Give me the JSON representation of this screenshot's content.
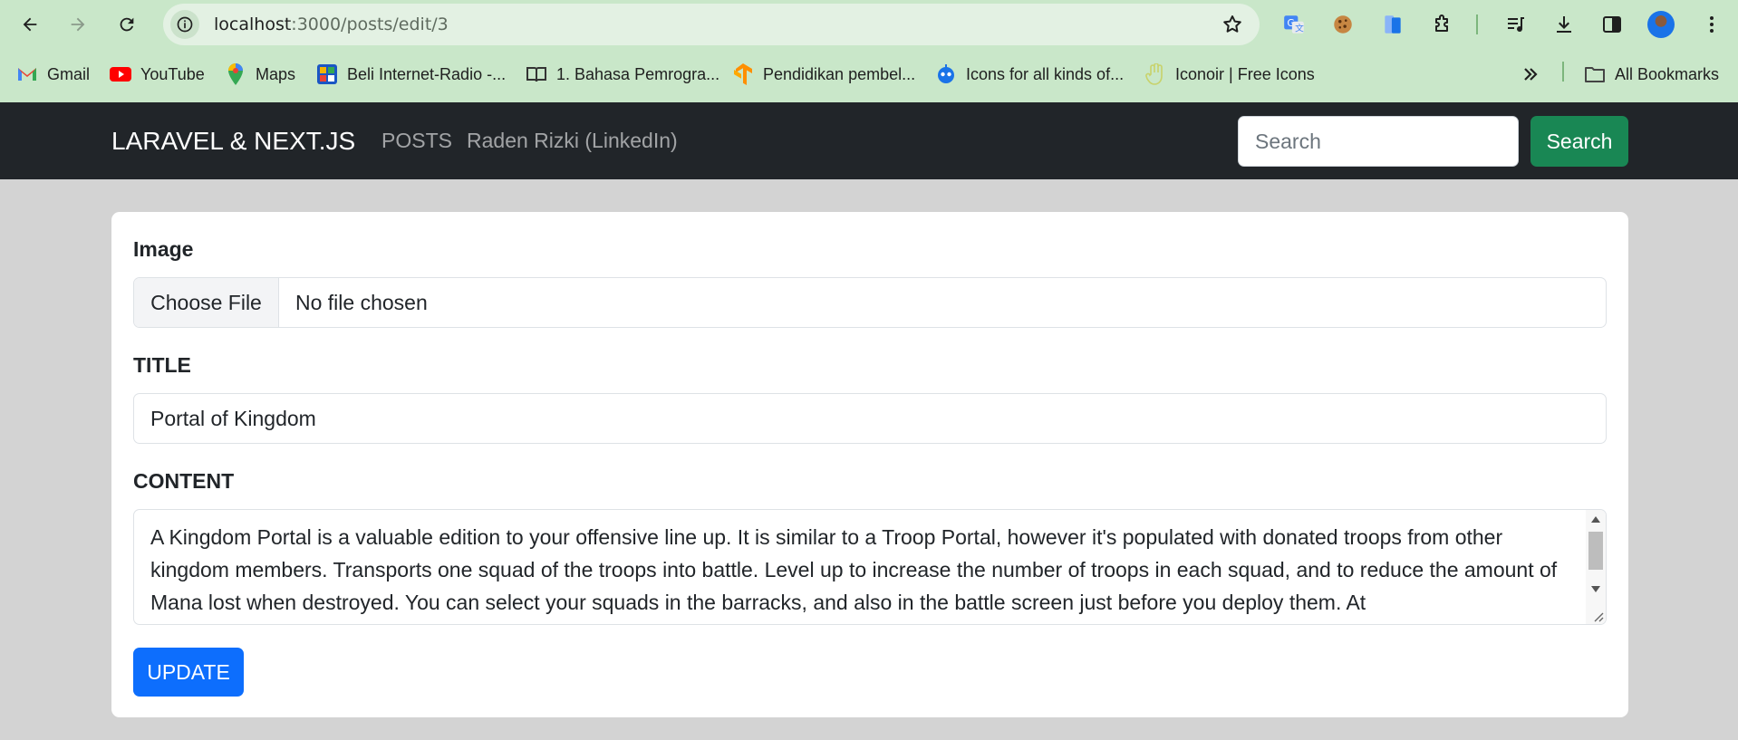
{
  "browser": {
    "url_host": "localhost",
    "url_path": ":3000/posts/edit/3",
    "bookmarks": [
      {
        "label": "Gmail",
        "icon": "gmail-icon"
      },
      {
        "label": "YouTube",
        "icon": "youtube-icon"
      },
      {
        "label": "Maps",
        "icon": "maps-icon"
      },
      {
        "label": "Beli Internet-Radio -...",
        "icon": "radio-icon"
      },
      {
        "label": "1. Bahasa Pemrogra...",
        "icon": "book-icon"
      },
      {
        "label": "Pendidikan pembel...",
        "icon": "tensorflow-icon"
      },
      {
        "label": "Icons for all kinds of...",
        "icon": "robot-icon"
      },
      {
        "label": "Iconoir | Free Icons",
        "icon": "hand-icon"
      }
    ],
    "all_bookmarks": "All Bookmarks"
  },
  "navbar": {
    "brand": "LARAVEL & NEXT.JS",
    "links": [
      "POSTS",
      "Raden Rizki (LinkedIn)"
    ],
    "search_placeholder": "Search",
    "search_button": "Search"
  },
  "form": {
    "image_label": "Image",
    "file_button": "Choose File",
    "file_status": "No file chosen",
    "title_label": "TITLE",
    "title_value": "Portal of Kingdom",
    "content_label": "CONTENT",
    "content_value": "A Kingdom Portal is a valuable edition to your offensive line up. It is similar to a Troop Portal, however it's populated with donated troops from other kingdom members. Transports one squad of the troops into battle. Level up to increase the number of troops in each squad, and to reduce the amount of Mana lost when destroyed. You can select your squads in the barracks, and also in the battle screen just before you deploy them. At",
    "update_button": "UPDATE"
  },
  "colors": {
    "chrome_bg": "#c9e7c9",
    "navbar_bg": "#212529",
    "search_button": "#198754",
    "update_button": "#0d6efd",
    "page_bg": "#d3d3d3"
  }
}
